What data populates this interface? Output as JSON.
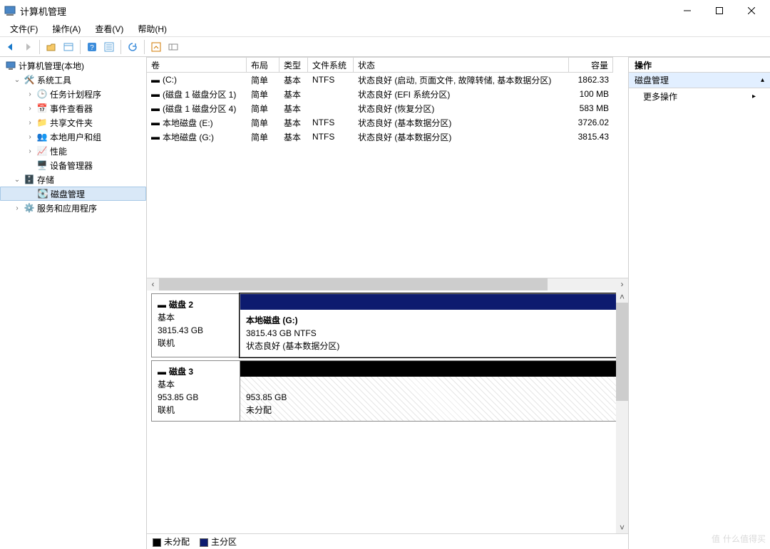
{
  "window": {
    "title": "计算机管理"
  },
  "menu": {
    "file": "文件(F)",
    "action": "操作(A)",
    "view": "查看(V)",
    "help": "帮助(H)"
  },
  "tree": {
    "root": "计算机管理(本地)",
    "sys_tools": "系统工具",
    "task_sched": "任务计划程序",
    "event_viewer": "事件查看器",
    "shared": "共享文件夹",
    "users": "本地用户和组",
    "perf": "性能",
    "devmgr": "设备管理器",
    "storage": "存储",
    "diskmgmt": "磁盘管理",
    "services": "服务和应用程序"
  },
  "volcols": {
    "volume": "卷",
    "layout": "布局",
    "type": "类型",
    "fs": "文件系统",
    "status": "状态",
    "capacity": "容量"
  },
  "volumes": [
    {
      "name": "(C:)",
      "layout": "简单",
      "type": "基本",
      "fs": "NTFS",
      "status": "状态良好 (启动, 页面文件, 故障转储, 基本数据分区)",
      "cap": "1862.33"
    },
    {
      "name": "(磁盘 1 磁盘分区 1)",
      "layout": "简单",
      "type": "基本",
      "fs": "",
      "status": "状态良好 (EFI 系统分区)",
      "cap": "100 MB"
    },
    {
      "name": "(磁盘 1 磁盘分区 4)",
      "layout": "简单",
      "type": "基本",
      "fs": "",
      "status": "状态良好 (恢复分区)",
      "cap": "583 MB"
    },
    {
      "name": "本地磁盘 (E:)",
      "layout": "简单",
      "type": "基本",
      "fs": "NTFS",
      "status": "状态良好 (基本数据分区)",
      "cap": "3726.02"
    },
    {
      "name": "本地磁盘 (G:)",
      "layout": "简单",
      "type": "基本",
      "fs": "NTFS",
      "status": "状态良好 (基本数据分区)",
      "cap": "3815.43"
    }
  ],
  "disks": {
    "d2": {
      "title": "磁盘 2",
      "type": "基本",
      "size": "3815.43 GB",
      "status": "联机",
      "part_name": "本地磁盘  (G:)",
      "part_line2": "3815.43 GB NTFS",
      "part_line3": "状态良好 (基本数据分区)"
    },
    "d3": {
      "title": "磁盘 3",
      "type": "基本",
      "size": "953.85 GB",
      "status": "联机",
      "part_line2": "953.85 GB",
      "part_line3": "未分配"
    }
  },
  "legend": {
    "unalloc": "未分配",
    "primary": "主分区"
  },
  "actions_pane": {
    "header": "操作",
    "section": "磁盘管理",
    "more": "更多操作"
  },
  "watermark": "什么值得买"
}
